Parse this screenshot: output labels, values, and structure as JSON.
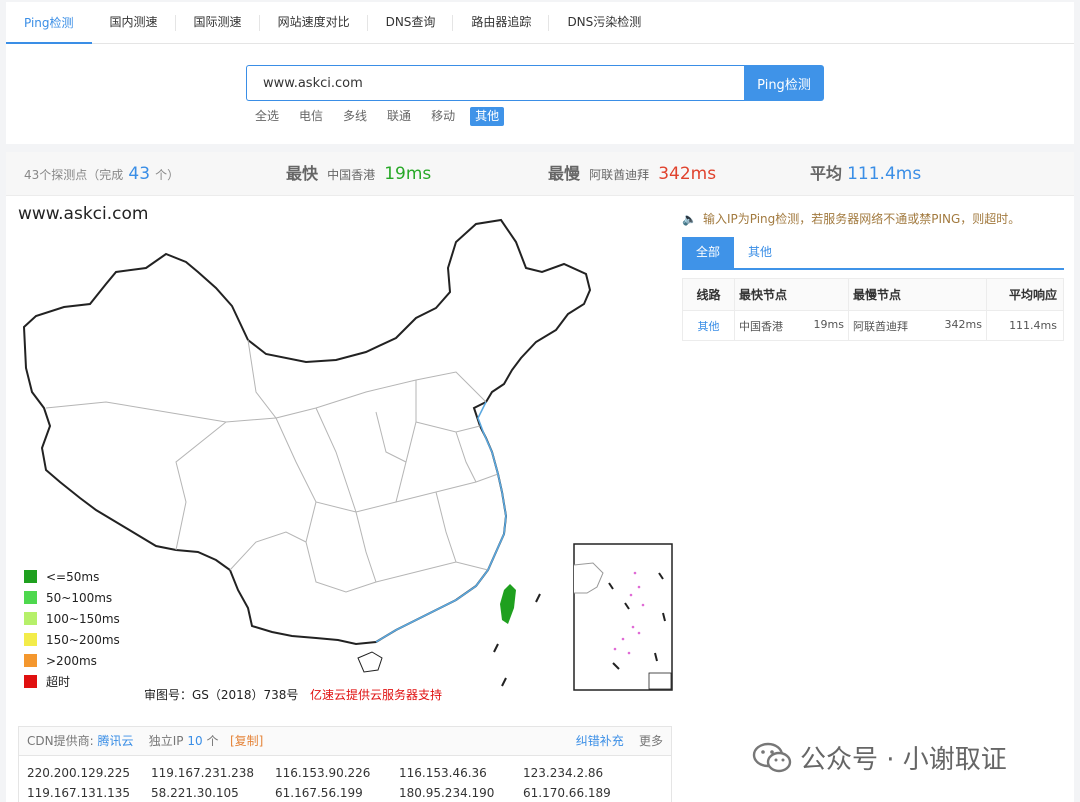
{
  "tabs": [
    {
      "label": "Ping检测",
      "active": true
    },
    {
      "label": "国内测速",
      "active": false
    },
    {
      "label": "国际测速",
      "active": false
    },
    {
      "label": "网站速度对比",
      "active": false
    },
    {
      "label": "DNS查询",
      "active": false
    },
    {
      "label": "路由器追踪",
      "active": false
    },
    {
      "label": "DNS污染检测",
      "active": false
    }
  ],
  "search": {
    "value": "www.askci.com",
    "button_label": "Ping检测"
  },
  "filters": [
    {
      "label": "全选",
      "active": false
    },
    {
      "label": "电信",
      "active": false
    },
    {
      "label": "多线",
      "active": false
    },
    {
      "label": "联通",
      "active": false
    },
    {
      "label": "移动",
      "active": false
    },
    {
      "label": "其他",
      "active": true
    }
  ],
  "stats": {
    "nodes_prefix": "43个探测点（完成",
    "nodes_done": "43",
    "nodes_suffix": "个）",
    "fastest_label": "最快",
    "fastest_place": "中国香港",
    "fastest_value": "19ms",
    "slowest_label": "最慢",
    "slowest_place": "阿联酋迪拜",
    "slowest_value": "342ms",
    "avg_label": "平均",
    "avg_value": "111.4ms"
  },
  "map": {
    "domain": "www.askci.com",
    "legend": [
      {
        "label": "<=50ms",
        "color": "#1fa01f"
      },
      {
        "label": "50~100ms",
        "color": "#4ed84e"
      },
      {
        "label": "100~150ms",
        "color": "#b6f06a"
      },
      {
        "label": "150~200ms",
        "color": "#f3ec4a"
      },
      {
        "label": ">200ms",
        "color": "#f4972e"
      },
      {
        "label": "超时",
        "color": "#e01010"
      }
    ],
    "approval": "审图号：GS（2018）738号",
    "support": "亿速云提供云服务器支持"
  },
  "notice": "输入IP为Ping检测，若服务器网络不通或禁PING，则超时。",
  "result_tabs": [
    {
      "label": "全部",
      "active": true
    },
    {
      "label": "其他",
      "active": false
    }
  ],
  "table": {
    "headers": [
      "线路",
      "最快节点",
      "最慢节点",
      "平均响应"
    ],
    "rows": [
      {
        "line": "其他",
        "fast_place": "中国香港",
        "fast_value": "19ms",
        "slow_place": "阿联酋迪拜",
        "slow_value": "342ms",
        "avg": "111.4ms"
      }
    ]
  },
  "cdn": {
    "provider_label": "CDN提供商:",
    "provider": "腾讯云",
    "ip_label": "独立IP",
    "ip_count": "10",
    "ip_unit": "个",
    "copy": "[复制]",
    "correct": "纠错补充",
    "more": "更多"
  },
  "ips": [
    [
      "220.200.129.225",
      "119.167.231.238",
      "116.153.90.226",
      "116.153.46.36",
      "123.234.2.86"
    ],
    [
      "119.167.131.135",
      "58.221.30.105",
      "61.167.56.199",
      "180.95.234.190",
      "61.170.66.189"
    ]
  ],
  "watermark": {
    "text": "公众号 · 小谢取证"
  },
  "colors": {
    "accent": "#3f93e8",
    "green": "#27a827",
    "red": "#e0422d",
    "taiwan_fill": "#1fa01f",
    "coast": "#5aa8e0"
  }
}
